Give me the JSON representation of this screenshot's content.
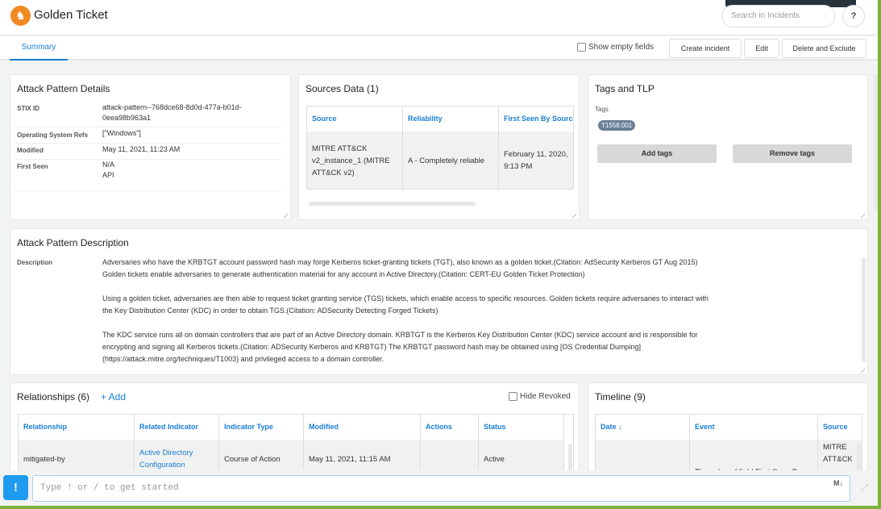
{
  "header": {
    "title": "Golden Ticket",
    "logo_icon": "chess-knight-icon",
    "search_placeholder": "Search in Incidents",
    "help_label": "?"
  },
  "tabs": [
    {
      "label": "Summary",
      "active": true
    }
  ],
  "toolbar": {
    "show_empty_fields_label": "Show empty fields",
    "show_empty_fields_checked": false,
    "create_incident_label": "Create incident",
    "edit_label": "Edit",
    "delete_exclude_label": "Delete and Exclude"
  },
  "details": {
    "title": "Attack Pattern Details",
    "rows": [
      {
        "label": "STIX ID",
        "value": "attack-pattern--768dce68-8d0d-477a-b01d-",
        "value2": "0eea98b963a1"
      },
      {
        "label": "Operating System Refs",
        "value": "[\"Windows\"]"
      },
      {
        "label": "Modified",
        "value": "May 11, 2021, 11:23 AM"
      },
      {
        "label": "First Seen",
        "value": "N/A",
        "value2": "API"
      }
    ]
  },
  "sources": {
    "title": "Sources Data (1)",
    "columns": [
      "Source",
      "Reliability",
      "First Seen By Source"
    ],
    "rows": [
      {
        "source": "MITRE ATT&CK v2_instance_1 (MITRE ATT&CK v2)",
        "reliability": "A - Completely reliable",
        "first_seen": "February 11, 2020, 9:13 PM"
      }
    ]
  },
  "tags": {
    "title": "Tags and TLP",
    "tags_label": "Tags",
    "items": [
      "T1558.001"
    ],
    "add_label": "Add tags",
    "remove_label": "Remove tags"
  },
  "description": {
    "title": "Attack Pattern Description",
    "label": "Description",
    "paragraphs": [
      "Adversaries who have the KRBTGT account password hash may forge Kerberos ticket-granting tickets (TGT), also known as a golden ticket.(Citation: AdSecurity Kerberos GT Aug 2015) Golden tickets enable adversaries to generate authentication material for any account in Active Directory.(Citation: CERT-EU Golden Ticket Protection)",
      "Using a golden ticket, adversaries are then able to request ticket granting service (TGS) tickets, which enable access to specific resources. Golden tickets require adversaries to interact with the Key Distribution Center (KDC) in order to obtain TGS.(Citation: ADSecurity Detecting Forged Tickets)",
      "The KDC service runs all on domain controllers that are part of an Active Directory domain. KRBTGT is the Kerberos Key Distribution Center (KDC) service account and is responsible for encrypting and signing all Kerberos tickets.(Citation: ADSecurity Kerberos and KRBTGT) The KRBTGT password hash may be obtained using [OS Credential Dumping](https://attack.mitre.org/techniques/T1003) and privileged access to a domain controller."
    ]
  },
  "relationships": {
    "title": "Relationships (6)",
    "add_label": "+ Add",
    "hide_revoked_label": "Hide Revoked",
    "hide_revoked_checked": false,
    "columns": [
      "Relationship",
      "Related Indicator",
      "Indicator Type",
      "Modified",
      "Actions",
      "Status"
    ],
    "rows": [
      {
        "relationship": "mitigated-by",
        "indicator": "Active Directory Configuration",
        "type": "Course of Action",
        "modified": "May 11, 2021, 11:15 AM",
        "actions": "",
        "status": "Active"
      }
    ]
  },
  "timeline": {
    "title": "Timeline (9)",
    "columns": [
      "Date ↓",
      "Event",
      "Source"
    ],
    "rows": [
      {
        "date": "",
        "event": "The value of field First Seen By",
        "source": "MITRE ATT&CK"
      }
    ]
  },
  "cli": {
    "bang": "!",
    "placeholder": "Type ! or / to get started",
    "markdown_label": "M↓"
  }
}
